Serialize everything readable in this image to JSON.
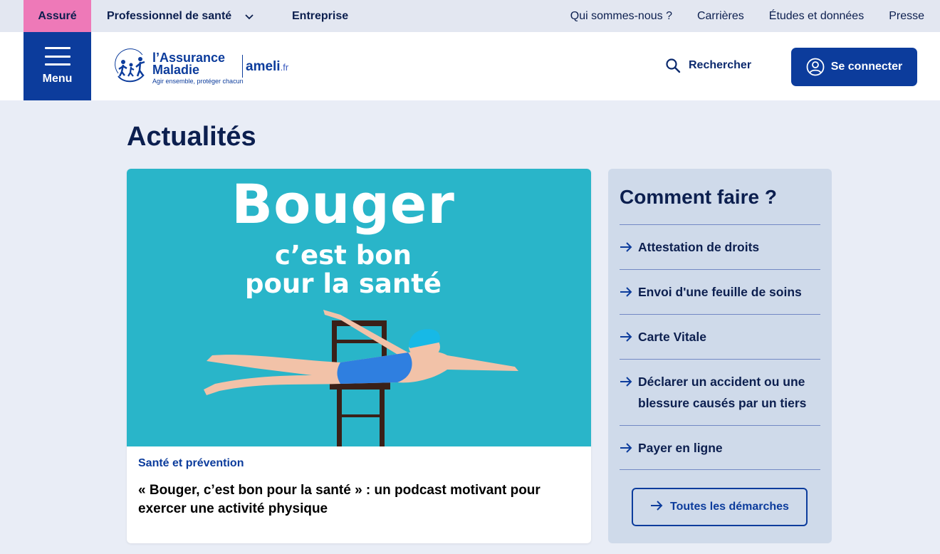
{
  "topbar": {
    "tabs": [
      {
        "label": "Assuré"
      },
      {
        "label": "Professionnel de santé"
      },
      {
        "label": "Entreprise"
      }
    ],
    "links": [
      "Qui sommes-nous ?",
      "Carrières",
      "Études et données",
      "Presse"
    ]
  },
  "header": {
    "menu_label": "Menu",
    "logo": {
      "line1": "l’Assurance",
      "line2": "Maladie",
      "tagline": "Agir ensemble, protéger chacun",
      "ameli": "ameli",
      "ameli_suffix": ".fr"
    },
    "search_label": "Rechercher",
    "connect_label": "Se connecter"
  },
  "page_title": "Actualités",
  "news": {
    "image": {
      "line1": "Bouger",
      "line2": "c’est bon",
      "line3": "pour la santé",
      "bg_color": "#29b5c9"
    },
    "category": "Santé et prévention",
    "headline": "« Bouger, c’est bon pour la santé » : un podcast motivant pour exercer une activité physique"
  },
  "howto": {
    "title": "Comment faire ?",
    "items": [
      {
        "label": "Attestation de droits"
      },
      {
        "label": "Envoi d'une feuille de soins"
      },
      {
        "label": "Carte Vitale"
      },
      {
        "label": "Déclarer un accident ou une blessure causés par un tiers"
      },
      {
        "label": "Payer en ligne"
      }
    ],
    "all_label": "Toutes les démarches"
  },
  "colors": {
    "brand_blue": "#0c3c9c",
    "assure_pink": "#ee79b8",
    "page_bg": "#e9edf6",
    "panel_bg": "#cfdaea"
  }
}
